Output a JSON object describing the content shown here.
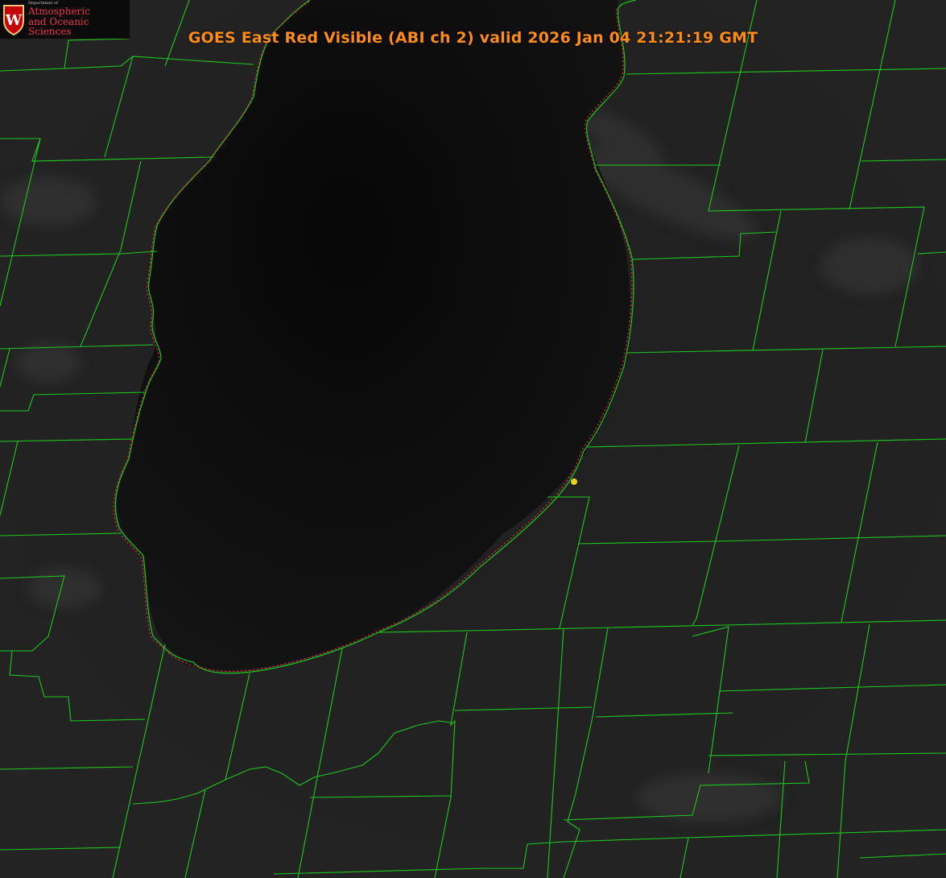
{
  "title": "GOES East Red Visible (ABI ch 2) valid 2026 Jan 04 21:21:19 GMT",
  "logo": {
    "department": "Department of",
    "line1": "Atmospheric",
    "line2": "and Oceanic Sciences",
    "crest_letter": "W"
  },
  "colors": {
    "boundary": "#1ec81e",
    "shoreline": "#ff3030",
    "title": "#ff8c1a",
    "marker": "#e6d21e",
    "logo_red": "#e8374c"
  },
  "icons": [
    "uw-crest-icon",
    "location-marker-icon"
  ]
}
